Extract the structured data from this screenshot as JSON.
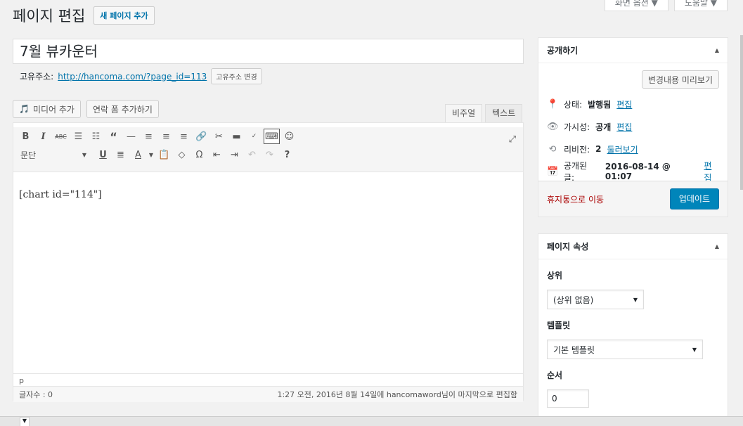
{
  "screen_tabs": [
    "화면 옵션 ▼",
    "도움말 ▼"
  ],
  "page": {
    "title": "페이지 편집",
    "add_new": "새 페이지 추가"
  },
  "post": {
    "title": "7월 뷰카운터",
    "permalink_label": "고유주소:",
    "permalink_url": "http://hancoma.com/?page_id=113",
    "permalink_button": "고유주소 변경"
  },
  "editor": {
    "add_media": "미디어 추가",
    "add_form": "연락 폼 추가하기",
    "tab_visual": "비주얼",
    "tab_text": "텍스트",
    "format_select": "문단",
    "content": "[chart id=\"114\"]",
    "path": "p",
    "word_count": "글자수 : 0",
    "last_edited": "1:27 오전, 2016년 8월 14일에 hancomaword님이 마지막으로 편집함"
  },
  "publish": {
    "title": "공개하기",
    "preview_button": "변경내용 미리보기",
    "status_label": "상태:",
    "status_value": "발행됨",
    "visibility_label": "가시성:",
    "visibility_value": "공개",
    "revisions_label": "리비전:",
    "revisions_value": "2",
    "revisions_link": "둘러보기",
    "published_label": "공개된 글:",
    "published_value": "2016-08-14 @ 01:07",
    "edit_link": "편집",
    "trash": "휴지통으로 이동",
    "update": "업데이트"
  },
  "attributes": {
    "title": "페이지 속성",
    "parent_label": "상위",
    "parent_value": "(상위 없음)",
    "template_label": "템플릿",
    "template_value": "기본 템플릿",
    "order_label": "순서",
    "order_value": "0"
  },
  "colors": {
    "primary": "#0085ba",
    "link": "#0073aa",
    "danger": "#a00000"
  }
}
